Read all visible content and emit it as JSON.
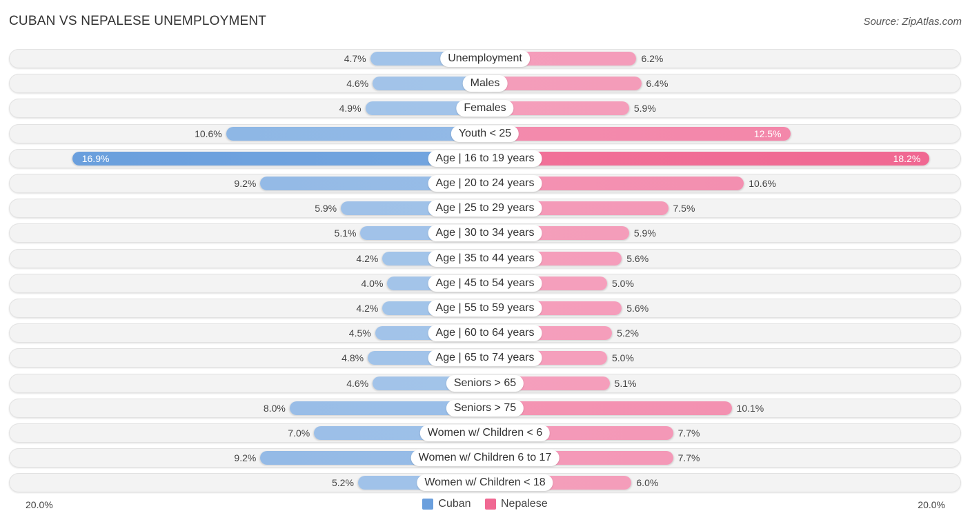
{
  "header": {
    "title": "CUBAN VS NEPALESE UNEMPLOYMENT",
    "source": "Source: ZipAtlas.com"
  },
  "chart_data": {
    "type": "bar",
    "orientation": "horizontal-diverging",
    "title": "CUBAN VS NEPALESE UNEMPLOYMENT",
    "unit": "%",
    "xlim": [
      -20,
      20
    ],
    "axis_labels": {
      "left": "20.0%",
      "right": "20.0%"
    },
    "legend": {
      "position": "bottom-center",
      "items": [
        "Cuban",
        "Nepalese"
      ]
    },
    "colors": {
      "Cuban": "#6a9fdd",
      "Cuban_light": "#a6c6ea",
      "Nepalese": "#f06892",
      "Nepalese_light": "#f5a3bf"
    },
    "categories": [
      "Unemployment",
      "Males",
      "Females",
      "Youth < 25",
      "Age | 16 to 19 years",
      "Age | 20 to 24 years",
      "Age | 25 to 29 years",
      "Age | 30 to 34 years",
      "Age | 35 to 44 years",
      "Age | 45 to 54 years",
      "Age | 55 to 59 years",
      "Age | 60 to 64 years",
      "Age | 65 to 74 years",
      "Seniors > 65",
      "Seniors > 75",
      "Women w/ Children < 6",
      "Women w/ Children 6 to 17",
      "Women w/ Children < 18"
    ],
    "series": [
      {
        "name": "Cuban",
        "side": "left",
        "values": [
          4.7,
          4.6,
          4.9,
          10.6,
          16.9,
          9.2,
          5.9,
          5.1,
          4.2,
          4.0,
          4.2,
          4.5,
          4.8,
          4.6,
          8.0,
          7.0,
          9.2,
          5.2
        ],
        "labels": [
          "4.7%",
          "4.6%",
          "4.9%",
          "10.6%",
          "16.9%",
          "9.2%",
          "5.9%",
          "5.1%",
          "4.2%",
          "4.0%",
          "4.2%",
          "4.5%",
          "4.8%",
          "4.6%",
          "8.0%",
          "7.0%",
          "9.2%",
          "5.2%"
        ]
      },
      {
        "name": "Nepalese",
        "side": "right",
        "values": [
          6.2,
          6.4,
          5.9,
          12.5,
          18.2,
          10.6,
          7.5,
          5.9,
          5.6,
          5.0,
          5.6,
          5.2,
          5.0,
          5.1,
          10.1,
          7.7,
          7.7,
          6.0
        ],
        "labels": [
          "6.2%",
          "6.4%",
          "5.9%",
          "12.5%",
          "18.2%",
          "10.6%",
          "7.5%",
          "5.9%",
          "5.6%",
          "5.0%",
          "5.6%",
          "5.2%",
          "5.0%",
          "5.1%",
          "10.1%",
          "7.7%",
          "7.7%",
          "6.0%"
        ]
      }
    ]
  }
}
